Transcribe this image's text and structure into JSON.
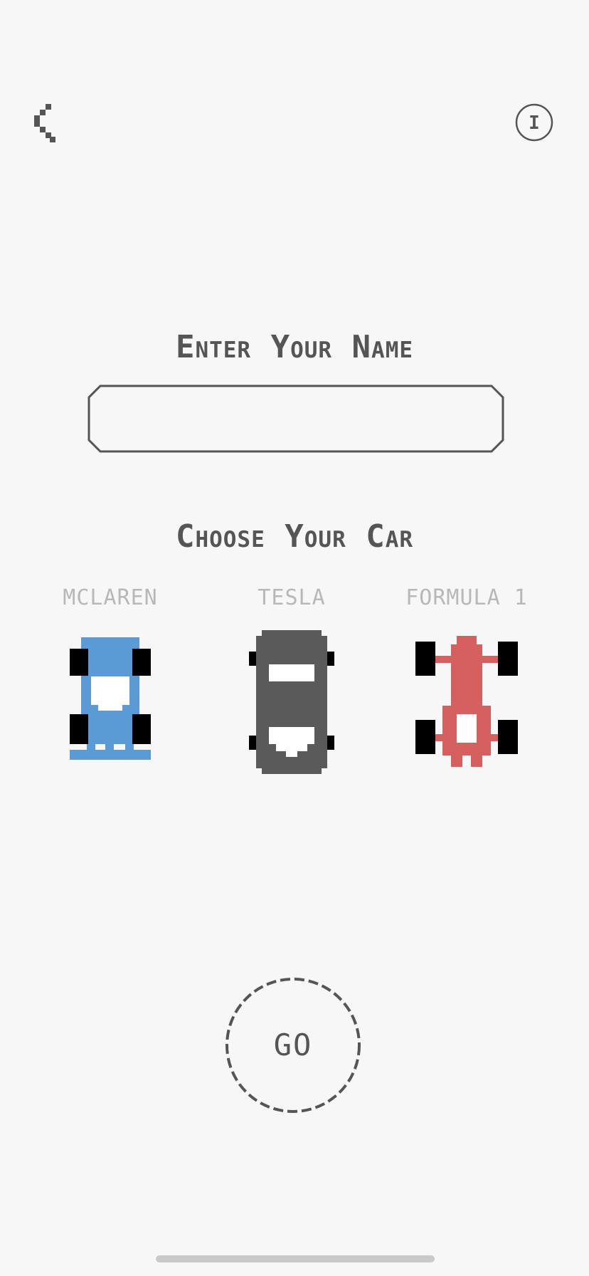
{
  "header": {
    "back_icon": "chevron-left-icon",
    "info_icon": "info-icon",
    "info_glyph": "I"
  },
  "name_section": {
    "title": "Enter Your Name",
    "input_value": "",
    "input_placeholder": ""
  },
  "car_section": {
    "title": "Choose Your Car",
    "cars": [
      {
        "label": "MCLAREN",
        "color": "#5b9bd5"
      },
      {
        "label": "TESLA",
        "color": "#5a5a5a"
      },
      {
        "label": "FORMULA 1",
        "color": "#d65f5f"
      }
    ]
  },
  "go_button": {
    "label": "GO"
  },
  "colors": {
    "background": "#f7f7f7",
    "ink": "#555555",
    "muted": "#b8b8b8",
    "wheel": "#000000"
  }
}
